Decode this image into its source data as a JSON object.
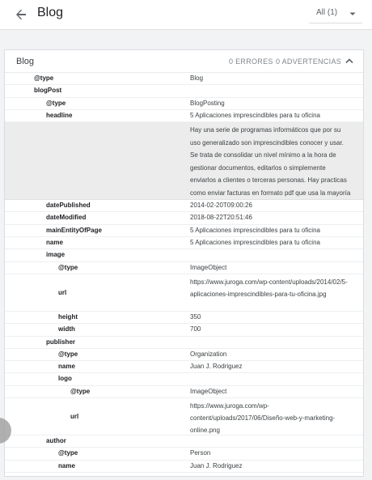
{
  "header": {
    "title": "Blog",
    "filter": "All (1)"
  },
  "card": {
    "title": "Blog",
    "errors": "0 ERRORES",
    "warnings": "0 ADVERTENCIAS"
  },
  "rows": {
    "type_label": "@type",
    "type_value": "Blog",
    "blogpost_label": "blogPost",
    "bp_type_label": "@type",
    "bp_type_value": "BlogPosting",
    "headline_label": "headline",
    "headline_value": "5 Aplicaciones imprescindibles para tu oficina",
    "description_value": "Hay una serie de programas informáticos que por su uso generalizado son imprescindibles conocer y usar. Se trata de consolidar un nivel mínimo a la hora de gestionar documentos, editarlos o simplemente enviarlos a clientes o terceras personas. Hay practicas como enviar facturas en formato pdf que usa la mayoría de empresas para agilizar cobros. Aunque una",
    "datepublished_label": "datePublished",
    "datepublished_value": "2014-02-20T09:00:26",
    "datemodified_label": "dateModified",
    "datemodified_value": "2018-08-22T20:51:46",
    "mainentity_label": "mainEntityOfPage",
    "mainentity_value": "5 Aplicaciones imprescindibles para tu oficina",
    "name_label": "name",
    "name_value": "5 Aplicaciones imprescindibles para tu oficina",
    "image_label": "image",
    "img_type_label": "@type",
    "img_type_value": "ImageObject",
    "img_url_label": "url",
    "img_url_value": "https://www.juroga.com/wp-content/uploads/2014/02/5-aplicaciones-imprescindibles-para-tu-oficina.jpg",
    "height_label": "height",
    "height_value": "350",
    "width_label": "width",
    "width_value": "700",
    "publisher_label": "publisher",
    "pub_type_label": "@type",
    "pub_type_value": "Organization",
    "pub_name_label": "name",
    "pub_name_value": "Juan J. Rodriguez",
    "logo_label": "logo",
    "logo_type_label": "@type",
    "logo_type_value": "ImageObject",
    "logo_url_label": "url",
    "logo_url_value": "https://www.juroga.com/wp-content/uploads/2017/06/Diseño-web-y-marketing-online.png",
    "author_label": "author",
    "author_type_label": "@type",
    "author_type_value": "Person",
    "author_name_label": "name",
    "author_name_value": "Juan J. Rodriguez"
  }
}
